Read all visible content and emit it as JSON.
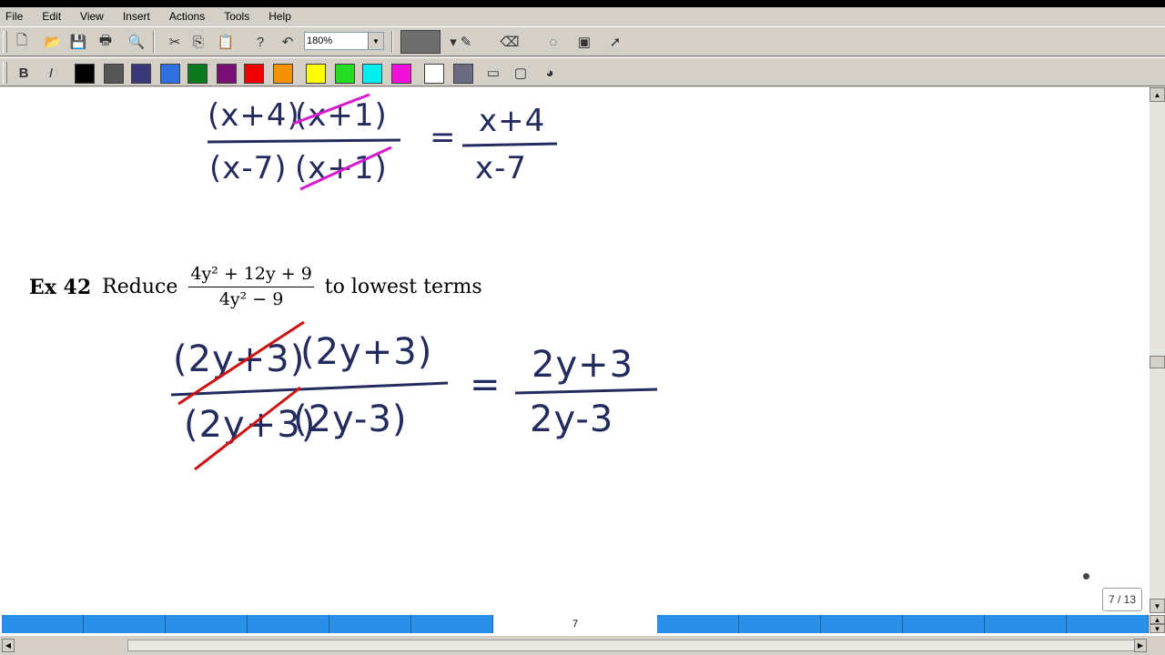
{
  "menu": [
    "File",
    "Edit",
    "View",
    "Insert",
    "Actions",
    "Tools",
    "Help"
  ],
  "toolbar": {
    "zoom_value": "180%",
    "icons": [
      "new-page-icon",
      "open-icon",
      "save-icon",
      "print-icon",
      "search-icon",
      "cut-icon",
      "copy-icon",
      "paste-icon",
      "help-icon",
      "undo-icon",
      "pen-icon",
      "pen-tool-icon",
      "eraser-icon",
      "lasso-icon",
      "screen-capture-icon",
      "pointer-icon"
    ]
  },
  "palette": {
    "colors": [
      "#000000",
      "#555555",
      "#3a3a7a",
      "#2f6fe0",
      "#0b7a1e",
      "#7a1076",
      "#f00000",
      "#f59000",
      "#ffff00",
      "#22dd22",
      "#00f0f0",
      "#f010d8",
      "#ffffff",
      "#6a6a80"
    ]
  },
  "content": {
    "previous_work": {
      "num_left": "(x+4)",
      "num_right": "(x+1)",
      "den_left": "(x-7)",
      "den_right": "(x+1)",
      "equals": "=",
      "res_num": "x+4",
      "res_den": "x-7"
    },
    "example": {
      "label": "Ex 42",
      "verb": "Reduce",
      "numerator": "4y² + 12y + 9",
      "denominator": "4y² − 9",
      "suffix": "to lowest terms"
    },
    "work": {
      "num_left": "(2y+3)",
      "num_right": "(2y+3)",
      "den_left": "(2y+3)",
      "den_right": "(2y-3)",
      "equals": "=",
      "res_num": "2y+3",
      "res_den": "2y-3"
    }
  },
  "page_indicator": "7 / 13",
  "page_tab_label": "7",
  "colors": {
    "ink": "#232b5e",
    "strike_magenta": "#d81ad0",
    "strike_red": "#d01010",
    "tab_blue": "#2a8fe6"
  }
}
